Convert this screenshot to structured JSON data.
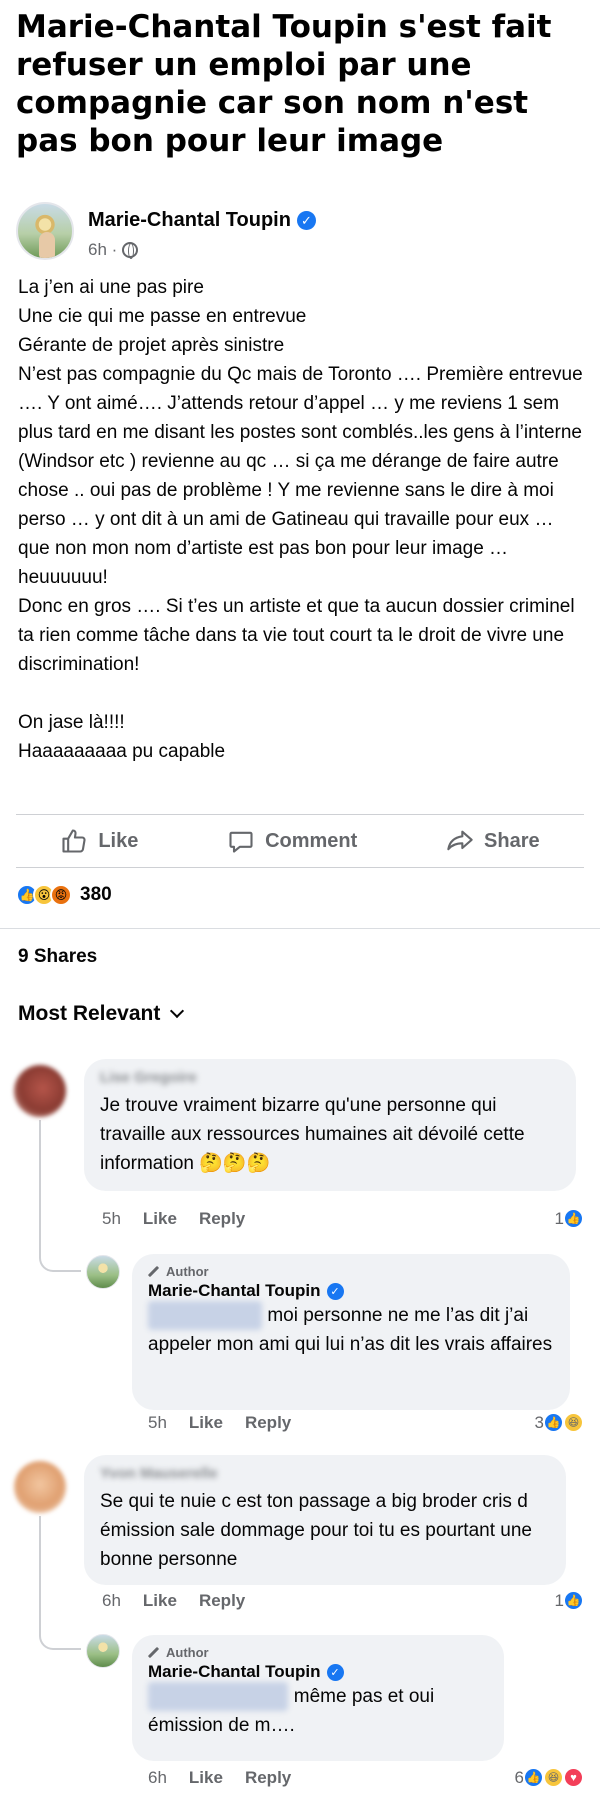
{
  "headline": "Marie-Chantal Toupin s'est fait refuser un emploi par une compagnie car son nom n'est pas bon pour leur image",
  "post": {
    "author": "Marie-Chantal Toupin",
    "time": "6h ·",
    "body_lines": [
      "La j’en ai une pas pire",
      "Une cie qui me passe en entrevue",
      "Gérante de projet après sinistre",
      "N’est pas compagnie du Qc mais de Toronto …. Première entrevue …. Y ont aimé…. J’attends retour d’appel … y me reviens 1 sem plus tard en me disant les postes sont comblés..les gens à l’interne (Windsor etc ) revienne au qc … si ça me dérange de faire autre chose .. oui pas de problème ! Y me revienne sans le dire à moi perso … y ont dit à un ami de Gatineau qui travaille pour eux … que non mon nom d’artiste est pas bon pour leur image … heuuuuuu!",
      "Donc en gros …. Si t’es un artiste et que ta aucun dossier criminel ta rien comme tâche dans ta vie tout court ta le droit de vivre une discrimination!",
      "",
      "On jase là!!!!",
      "Haaaaaaaaa pu capable"
    ],
    "actions": {
      "like": "Like",
      "comment": "Comment",
      "share": "Share"
    },
    "reaction_count": "380",
    "shares": "9 Shares",
    "sort_label": "Most Relevant"
  },
  "comments": [
    {
      "name": "Lise Gregoire",
      "text": "Je trouve vraiment bizarre qu'une personne qui travaille aux ressources humaines ait dévoilé cette information 🤔🤔🤔",
      "time": "5h",
      "like": "Like",
      "reply": "Reply",
      "reaction_count": "1",
      "reply_item": {
        "badge": "Author",
        "name": "Marie-Chantal Toupin",
        "mention": "Lise Gregoire",
        "text": "moi personne ne me l’as dit j’ai appeler mon ami qui lui n’as dit les vrais affaires",
        "time": "5h",
        "like": "Like",
        "reply": "Reply",
        "reaction_count": "3"
      }
    },
    {
      "name": "Yvon Mauserelle",
      "text": "Se qui te nuie c est ton passage a big broder cris d émission sale dommage pour toi tu es pourtant une bonne personne",
      "time": "6h",
      "like": "Like",
      "reply": "Reply",
      "reaction_count": "1",
      "reply_item": {
        "badge": "Author",
        "name": "Marie-Chantal Toupin",
        "mention": "Yvon Mauserelle",
        "text": "même pas et oui émission de m….",
        "time": "6h",
        "like": "Like",
        "reply": "Reply",
        "reaction_count": "6"
      }
    }
  ],
  "colors": {
    "accent": "#1877f2",
    "secondary_text": "#65676b",
    "bubble": "#f0f2f5"
  }
}
